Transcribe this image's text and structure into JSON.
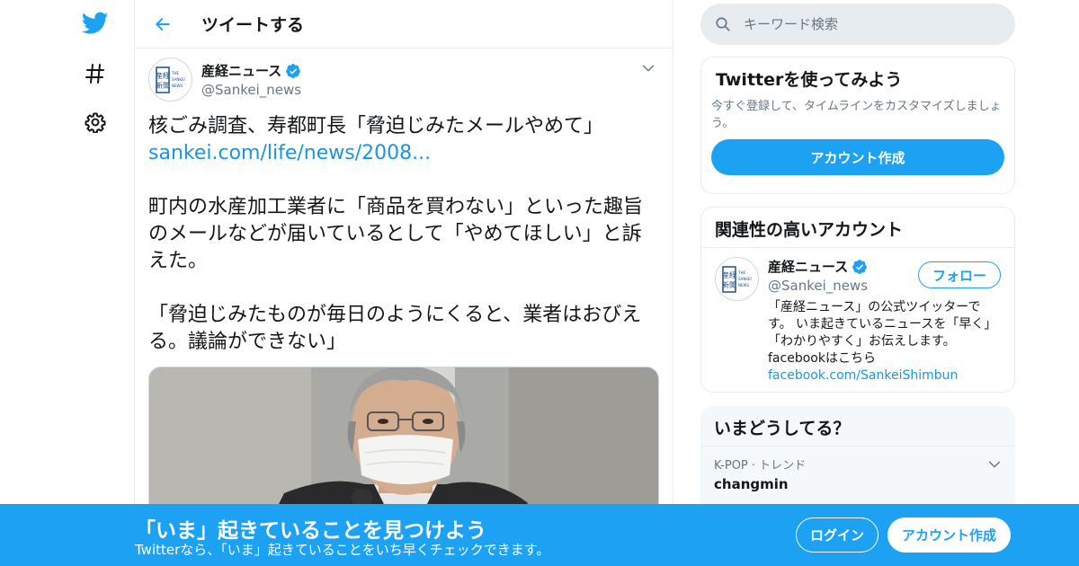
{
  "colors": {
    "accent": "#1da1f2",
    "link": "#1b95e0",
    "muted": "#657786",
    "border": "#e6ecf0"
  },
  "nav": {
    "icons": [
      "twitter-bird-icon",
      "hashtag-icon",
      "gear-icon"
    ]
  },
  "header": {
    "title": "ツイートする"
  },
  "tweet": {
    "author_name": "産経ニュース",
    "author_handle": "@Sankei_news",
    "logo_text": {
      "kanji": [
        "産経",
        "新聞"
      ],
      "latin": [
        "THE",
        "SANKEI",
        "NEWS"
      ]
    },
    "line1": "核ごみ調査、寿都町長「脅迫じみたメールやめて」",
    "link": "sankei.com/life/news/2008...",
    "paragraph2": "町内の水産加工業者に「商品を買わない」といった趣旨のメールなどが届いているとして「やめてほしい」と訴えた。",
    "paragraph3": "「脅迫じみたものが毎日のようにくると、業者はおびえる。議論ができない」"
  },
  "search": {
    "placeholder": "キーワード検索"
  },
  "try_card": {
    "title": "Twitterを使ってみよう",
    "description": "今すぐ登録して、タイムラインをカスタマイズしましょう。",
    "button": "アカウント作成"
  },
  "related_card": {
    "title": "関連性の高いアカウント",
    "account": {
      "name": "産経ニュース",
      "handle": "@Sankei_news",
      "follow_label": "フォロー",
      "bio": "「産経ニュース」の公式ツイッターです。 いま起きているニュースを「早く」「わかりやすく」お伝えします。 facebookはこちら",
      "link": "facebook.com/SankeiShimbun"
    }
  },
  "trends_card": {
    "title": "いまどうしてる？",
    "items": [
      {
        "meta": "K-POP · トレンド",
        "name": "changmin"
      }
    ]
  },
  "banner": {
    "title": "「いま」起きていることを見つけよう",
    "subtitle": "Twitterなら、「いま」起きていることをいち早くチェックできます。",
    "login": "ログイン",
    "signup": "アカウント作成"
  }
}
